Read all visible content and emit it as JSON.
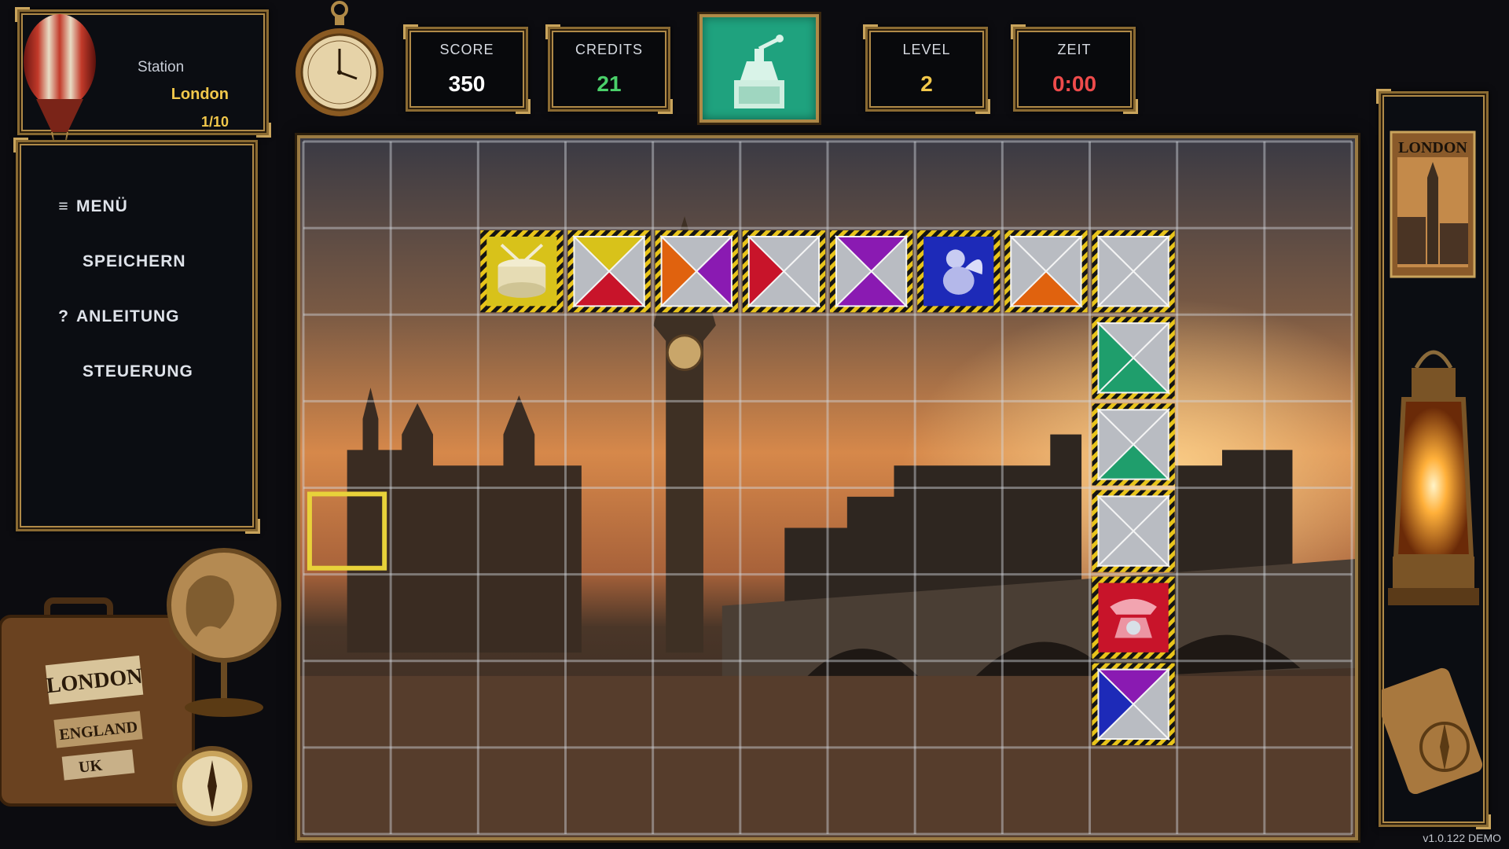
{
  "station": {
    "label": "Station",
    "city": "London",
    "progress": "1/10"
  },
  "menu": {
    "items": [
      {
        "glyph": "≡",
        "label": "MENÜ"
      },
      {
        "glyph": "",
        "label": "SPEICHERN"
      },
      {
        "glyph": "?",
        "label": "ANLEITUNG"
      },
      {
        "glyph": "",
        "label": "STEUERUNG"
      }
    ]
  },
  "stats": {
    "score": {
      "label": "SCORE",
      "value": "350"
    },
    "credits": {
      "label": "CREDITS",
      "value": "21"
    },
    "level": {
      "label": "LEVEL",
      "value": "2"
    },
    "time": {
      "label": "ZEIT",
      "value": "0:00"
    }
  },
  "next_tile": {
    "icon": "coffee-grinder-icon"
  },
  "board": {
    "cols": 12,
    "rows": 8,
    "cursor": {
      "col": 0,
      "row": 4
    },
    "colors": {
      "yellow": "#d8c21a",
      "red": "#c8142a",
      "orange": "#e0620e",
      "purple": "#8a1ab2",
      "green": "#1f9e6c",
      "blue": "#1d2ab8",
      "gray": "#b9bcc2"
    },
    "tiles": [
      {
        "col": 2,
        "row": 1,
        "kind": "icon",
        "icon": "drum-icon",
        "bg": "#d8c21a"
      },
      {
        "col": 3,
        "row": 1,
        "kind": "x",
        "top": "yellow",
        "right": "gray",
        "bottom": "red",
        "left": "gray"
      },
      {
        "col": 4,
        "row": 1,
        "kind": "x",
        "top": "gray",
        "right": "purple",
        "bottom": "gray",
        "left": "orange"
      },
      {
        "col": 5,
        "row": 1,
        "kind": "x",
        "top": "gray",
        "right": "gray",
        "bottom": "gray",
        "left": "red"
      },
      {
        "col": 6,
        "row": 1,
        "kind": "x",
        "top": "purple",
        "right": "gray",
        "bottom": "purple",
        "left": "gray"
      },
      {
        "col": 7,
        "row": 1,
        "kind": "icon",
        "icon": "cherub-icon",
        "bg": "#1d2ab8"
      },
      {
        "col": 8,
        "row": 1,
        "kind": "x",
        "top": "gray",
        "right": "gray",
        "bottom": "orange",
        "left": "gray"
      },
      {
        "col": 9,
        "row": 1,
        "kind": "x",
        "top": "gray",
        "right": "gray",
        "bottom": "gray",
        "left": "gray"
      },
      {
        "col": 9,
        "row": 2,
        "kind": "x",
        "top": "gray",
        "right": "gray",
        "bottom": "green",
        "left": "green"
      },
      {
        "col": 9,
        "row": 3,
        "kind": "x",
        "top": "gray",
        "right": "gray",
        "bottom": "green",
        "left": "gray"
      },
      {
        "col": 9,
        "row": 4,
        "kind": "x",
        "top": "gray",
        "right": "gray",
        "bottom": "gray",
        "left": "gray"
      },
      {
        "col": 9,
        "row": 5,
        "kind": "icon",
        "icon": "telephone-icon",
        "bg": "#c8142a"
      },
      {
        "col": 9,
        "row": 6,
        "kind": "x",
        "top": "purple",
        "right": "gray",
        "bottom": "gray",
        "left": "blue"
      }
    ]
  },
  "decor": {
    "suitcase_lines": [
      "LONDON",
      "ENGLAND",
      "UK"
    ],
    "card_title": "LONDON"
  },
  "version": "v1.0.122 DEMO"
}
